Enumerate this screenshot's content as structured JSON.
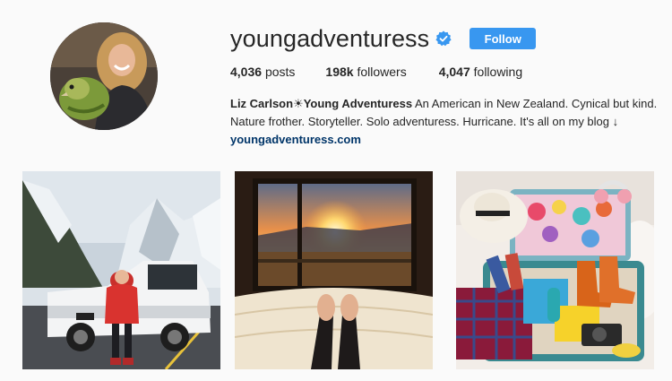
{
  "profile": {
    "username": "youngadventuress",
    "verified_icon": "verified-badge-icon",
    "follow_label": "Follow",
    "accent_color": "#3897f0"
  },
  "stats": {
    "posts_value": "4,036",
    "posts_label": "posts",
    "followers_value": "198k",
    "followers_label": "followers",
    "following_value": "4,047",
    "following_label": "following"
  },
  "bio": {
    "name": "Liz Carlson☀Young Adventuress",
    "text": " An American in New Zealand. Cynical but kind. Nature frother. Storyteller. Solo adventuress. Hurricane. It's all on my blog ↓",
    "link": "youngadventuress.com"
  },
  "posts": [
    {
      "icon": "photo-truck-mountains"
    },
    {
      "icon": "photo-sunset-bedroom"
    },
    {
      "icon": "photo-packed-suitcase"
    }
  ]
}
